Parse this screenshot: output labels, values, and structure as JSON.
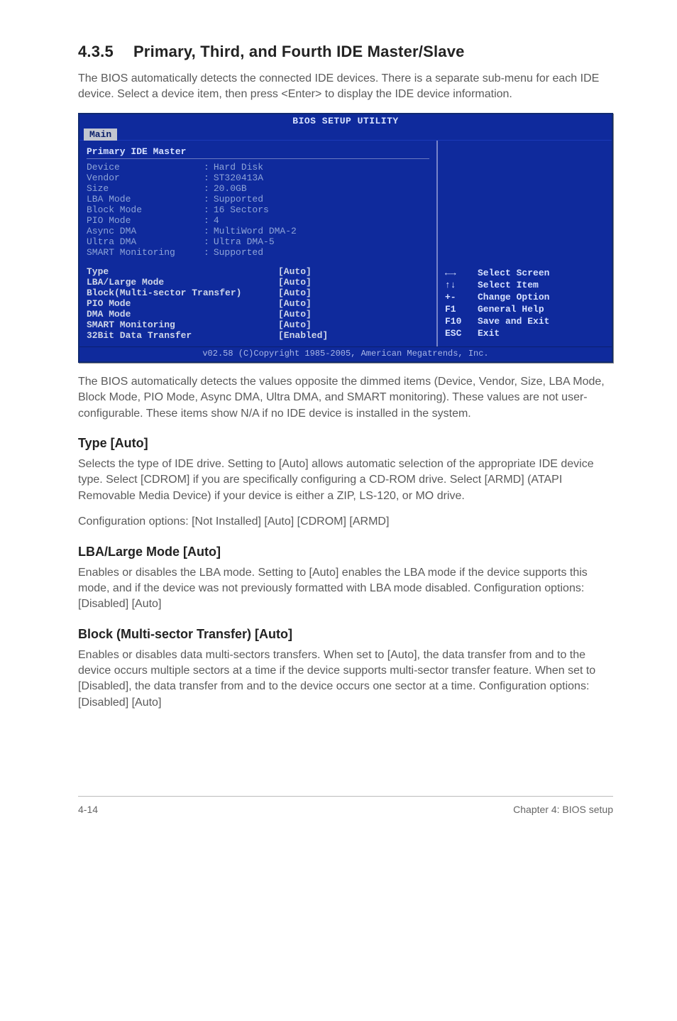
{
  "section": {
    "number": "4.3.5",
    "title": "Primary, Third, and Fourth IDE Master/Slave"
  },
  "intro": "The BIOS automatically detects the connected IDE devices. There is a separate sub-menu for each IDE device. Select a device item, then press <Enter> to display the IDE device information.",
  "bios": {
    "title": "BIOS SETUP UTILITY",
    "tab": "Main",
    "leftTitle": "Primary IDE Master",
    "device": [
      {
        "label": "Device",
        "value": "Hard Disk"
      },
      {
        "label": "Vendor",
        "value": "ST320413A"
      },
      {
        "label": "Size",
        "value": "20.0GB"
      },
      {
        "label": "LBA Mode",
        "value": "Supported"
      },
      {
        "label": "Block Mode",
        "value": "16 Sectors"
      },
      {
        "label": "PIO Mode",
        "value": "4"
      },
      {
        "label": "Async DMA",
        "value": "MultiWord DMA-2"
      },
      {
        "label": "Ultra DMA",
        "value": "Ultra DMA-5"
      },
      {
        "label": "SMART Monitoring",
        "value": "Supported"
      }
    ],
    "options": [
      {
        "label": "Type",
        "value": "[Auto]"
      },
      {
        "label": "LBA/Large Mode",
        "value": "[Auto]"
      },
      {
        "label": "Block(Multi-sector Transfer)",
        "value": "[Auto]"
      },
      {
        "label": "PIO Mode",
        "value": "[Auto]"
      },
      {
        "label": "DMA Mode",
        "value": "[Auto]"
      },
      {
        "label": "SMART Monitoring",
        "value": "[Auto]"
      },
      {
        "label": "32Bit Data Transfer",
        "value": "[Enabled]"
      }
    ],
    "help": [
      {
        "key": "←→",
        "desc": "Select Screen"
      },
      {
        "key": "↑↓",
        "desc": "Select Item"
      },
      {
        "key": "+-",
        "desc": "Change Option"
      },
      {
        "key": "F1",
        "desc": "General Help"
      },
      {
        "key": "F10",
        "desc": "Save and Exit"
      },
      {
        "key": "ESC",
        "desc": "Exit"
      }
    ],
    "footer": "v02.58 (C)Copyright 1985-2005, American Megatrends, Inc."
  },
  "afterBios": "The BIOS automatically detects the values opposite the dimmed items (Device, Vendor, Size, LBA Mode, Block Mode, PIO Mode, Async DMA, Ultra DMA, and SMART monitoring). These values are not user-configurable. These items show N/A if no IDE device is installed in the system.",
  "subs": {
    "type": {
      "title": "Type [Auto]",
      "p1": "Selects the type of IDE drive. Setting to [Auto] allows automatic selection of the appropriate IDE device type. Select [CDROM] if you are specifically configuring a CD-ROM drive. Select [ARMD] (ATAPI Removable Media Device) if your device is either a ZIP, LS-120, or MO drive.",
      "p2": "Configuration options: [Not Installed] [Auto] [CDROM] [ARMD]"
    },
    "lba": {
      "title": "LBA/Large Mode [Auto]",
      "p1": "Enables or disables the LBA mode. Setting to [Auto] enables the LBA mode if the device supports this mode, and if the device was not previously formatted with LBA mode disabled. Configuration options: [Disabled] [Auto]"
    },
    "block": {
      "title": "Block (Multi-sector Transfer) [Auto]",
      "p1": "Enables or disables data multi-sectors transfers. When set to [Auto], the data transfer from and to the device occurs multiple sectors at a time if the device supports multi-sector transfer feature. When set to [Disabled], the data transfer from and to the device occurs one sector at a time. Configuration options: [Disabled] [Auto]"
    }
  },
  "footer": {
    "left": "4-14",
    "right": "Chapter 4: BIOS setup"
  }
}
